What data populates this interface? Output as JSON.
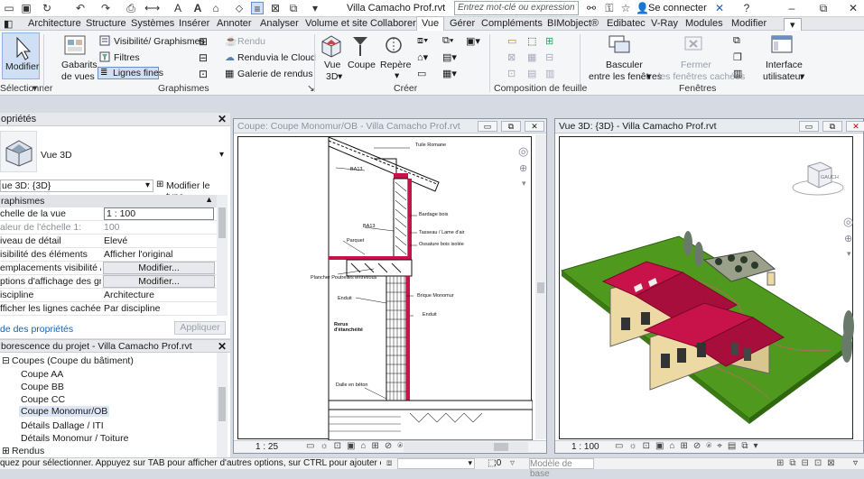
{
  "app": {
    "title": "Villa Camacho Prof.rvt",
    "search_placeholder": "Entrez mot-clé ou expression",
    "signin": "Se connecter"
  },
  "tabs": [
    "Architecture",
    "Structure",
    "Systèmes",
    "Insérer",
    "Annoter",
    "Analyser",
    "Volume et site",
    "Collaborer",
    "Vue",
    "Gérer",
    "Compléments",
    "BIMobject®",
    "Edibatec",
    "V-Ray",
    "Modules",
    "Modifier"
  ],
  "ribbon": {
    "select": {
      "label": "Modifier",
      "group": "Sélectionner"
    },
    "graphics": {
      "group": "Graphismes",
      "gabarits": "Gabarits",
      "de_vues": "de vues",
      "vis_graph": "Visibilité/ Graphismes",
      "filtres": "Filtres",
      "lignes_fines": "Lignes fines",
      "rendu": "Rendu",
      "rendu_cloud": "Rendu",
      "via_cloud": "via le Cloud",
      "galerie": "Galerie de rendus"
    },
    "create": {
      "group": "Créer",
      "vue": "Vue",
      "vue3d": "3D",
      "coupe": "Coupe",
      "repere": "Repère"
    },
    "sheet": {
      "group": "Composition de feuille"
    },
    "windows": {
      "group": "Fenêtres",
      "basculer": "Basculer",
      "entre": "entre les fenêtres",
      "fermer": "Fermer",
      "fermer2": "les fenêtres cachées",
      "interface": "Interface",
      "utilisateur": "utilisateur"
    }
  },
  "properties": {
    "title": "opriétés",
    "type_name": "Vue 3D",
    "selector": "ue 3D: {3D}",
    "edit_type": "Modifier le type",
    "category": "raphismes",
    "rows": [
      {
        "k": "chelle de la vue",
        "v": "1 : 100"
      },
      {
        "k": "aleur de l'échelle    1:",
        "v": "100"
      },
      {
        "k": "iveau de détail",
        "v": "Elevé"
      },
      {
        "k": "isibilité des éléments",
        "v": "Afficher l'original"
      },
      {
        "k": "emplacements visibilité / ...",
        "v": "Modifier..."
      },
      {
        "k": "ptions d'affichage des gr...",
        "v": "Modifier..."
      },
      {
        "k": "iscipline",
        "v": "Architecture"
      },
      {
        "k": "fficher les lignes cachées",
        "v": "Par discipline"
      }
    ],
    "help_link": "de des propriétés",
    "apply": "Appliquer"
  },
  "browser": {
    "title": "borescence du projet - Villa Camacho Prof.rvt",
    "items": [
      {
        "label": "Coupes (Coupe du bâtiment)",
        "indent": 1,
        "toggle": "⊟"
      },
      {
        "label": "Coupe AA",
        "indent": 2
      },
      {
        "label": "Coupe BB",
        "indent": 2
      },
      {
        "label": "Coupe CC",
        "indent": 2
      },
      {
        "label": "Coupe Monomur/OB",
        "indent": 2,
        "selected": true
      },
      {
        "label": "Détails Dallage / ITI",
        "indent": 2
      },
      {
        "label": "Détails Monomur / Toiture",
        "indent": 2
      },
      {
        "label": "Rendus",
        "indent": 1,
        "toggle": "⊞"
      }
    ]
  },
  "section_view": {
    "title": "Coupe: Coupe Monomur/OB - Villa Camacho Prof.rvt",
    "scale": "1 : 25",
    "annotations": [
      "Tuile Romane",
      "BA13",
      "Bardage bois",
      "BA13",
      "Tasseau / Lame d'air",
      "Ossature bois isolée",
      "Parquet",
      "Plancher Poutrelles entrevous",
      "Brique Monomur",
      "Enduit",
      "Enduit",
      "Rerus d'étanchéité",
      "Dalle en béton"
    ]
  },
  "view3d": {
    "title": "Vue 3D: {3D} - Villa Camacho Prof.rvt",
    "scale": "1 : 100",
    "cube_face": "GAUCH"
  },
  "status": {
    "hint": "quez pour sélectionner. Appuyez sur TAB pour afficher d'autres options, sur CTRL pour ajouter et sur M",
    "selcount": ":0",
    "model": "Modèle de base"
  },
  "colors": {
    "roof": "#c8124a",
    "grass": "#4f9a1e",
    "wall": "#ecd9a4"
  }
}
